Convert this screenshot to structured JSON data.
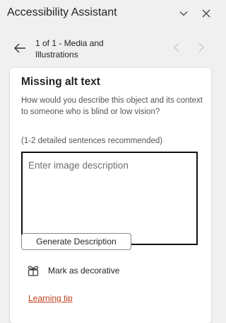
{
  "header": {
    "title": "Accessibility Assistant"
  },
  "nav": {
    "position_text": "1 of 1 - Media and Illustrations"
  },
  "card": {
    "title": "Missing alt text",
    "description": "How would you describe this object and its context to someone who is blind or low vision?",
    "hint": "(1-2 detailed sentences recommended)",
    "textbox_placeholder": "Enter image description",
    "textbox_value": "",
    "generate_button": "Generate Description",
    "decorative_label": "Mark as decorative",
    "learning_tip": "Learning tip"
  },
  "colors": {
    "link": "#c43e1c",
    "panel_bg": "#f0f0f0",
    "card_bg": "#ffffff"
  },
  "icons": [
    "chevron-down-icon",
    "close-icon",
    "back-arrow-icon",
    "prev-chevron-icon",
    "next-chevron-icon",
    "decorative-icon"
  ]
}
